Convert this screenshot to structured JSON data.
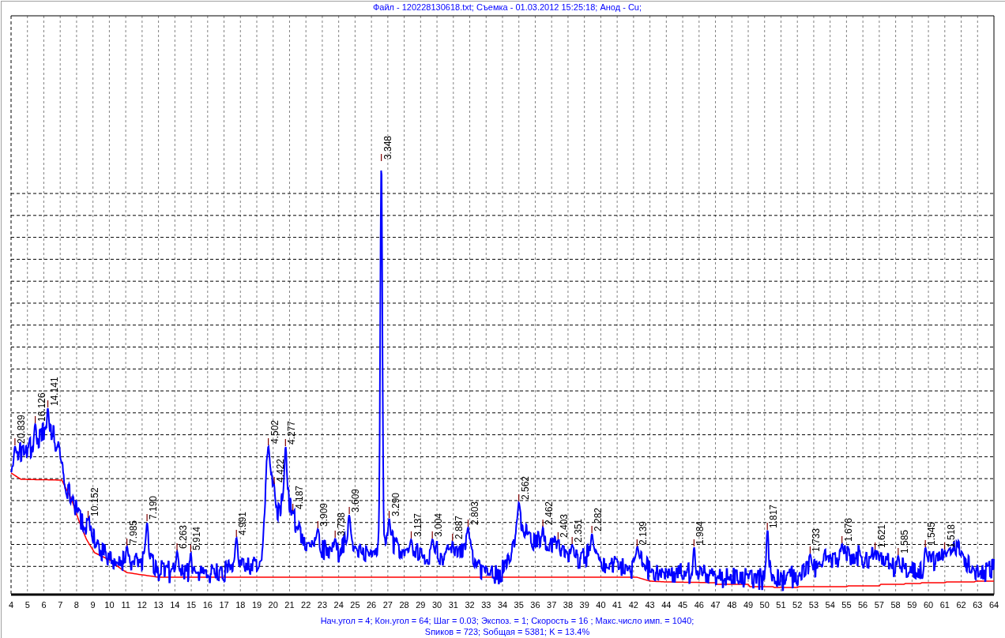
{
  "title": "Файл - 120228130618.txt; Съемка - 01.03.2012 15:25:18; Анод - Cu;",
  "chart": {
    "x_axis_ticks": [
      "4",
      "5",
      "6",
      "7",
      "8",
      "9",
      "10",
      "11",
      "12",
      "13",
      "14",
      "15",
      "16",
      "17",
      "18",
      "19",
      "20",
      "21",
      "22",
      "23",
      "24",
      "25",
      "26",
      "27",
      "28",
      "29",
      "30",
      "31",
      "32",
      "33",
      "34",
      "35",
      "36",
      "37",
      "38",
      "39",
      "40",
      "41",
      "42",
      "43",
      "44",
      "45",
      "46",
      "47",
      "48",
      "49",
      "50",
      "51",
      "52",
      "53",
      "54",
      "55",
      "56",
      "57",
      "58",
      "59",
      "60",
      "61",
      "62",
      "63",
      "64"
    ],
    "peak_labels": [
      "20.839",
      "16.126",
      "14.141",
      "10.152",
      "7.985",
      "7.190",
      "6.263",
      "5.914",
      "4.991",
      "4.502",
      "4.422",
      "4.277",
      "4.187",
      "3.909",
      "3.738",
      "3.609",
      "3.348",
      "3.290",
      "3.137",
      "3.004",
      "2.887",
      "2.803",
      "2.562",
      "2.462",
      "2.403",
      "2.351",
      "2.282",
      "2.139",
      "1.984",
      "1.817",
      "1.733",
      "1.676",
      "1.621",
      "1.585",
      "1.545",
      "1.518"
    ]
  },
  "footer": [
    "Нач.угол = 4; Кон.угол = 64; Шаг = 0.03; Экспоз. = 1; Скорость = 16 ; Макс.число имп. = 1040;",
    "Sпиков = 723; Sобщая = 5381; K = 13.4%"
  ]
}
